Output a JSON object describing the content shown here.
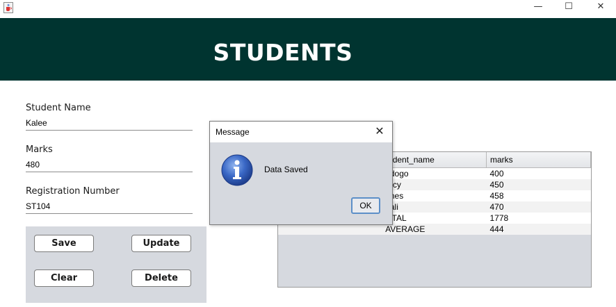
{
  "window": {
    "minimize_glyph": "—",
    "maximize_glyph": "☐",
    "close_glyph": "✕",
    "icon": "java-cup-icon"
  },
  "header": {
    "title": "STUDENTS"
  },
  "form": {
    "student_name_label": "Student Name",
    "student_name_value": "Kalee",
    "marks_label": "Marks",
    "marks_value": "480",
    "reg_label": "Registration Number",
    "reg_value": "ST104"
  },
  "buttons": {
    "save": "Save",
    "update": "Update",
    "clear": "Clear",
    "delete": "Delete"
  },
  "table": {
    "columns": [
      "",
      "tudent_name",
      "marks"
    ],
    "rows": [
      [
        "",
        "adogo",
        "400"
      ],
      [
        "",
        "ercy",
        "450"
      ],
      [
        "",
        "ones",
        "458"
      ],
      [
        "",
        "hali",
        "470"
      ],
      [
        "",
        "OTAL",
        "1778"
      ],
      [
        "",
        "AVERAGE",
        "444"
      ]
    ]
  },
  "dialog": {
    "title": "Message",
    "close_glyph": "✕",
    "message": "Data Saved",
    "ok_label": "OK",
    "icon": "info-icon"
  },
  "colors": {
    "header_bg": "#003430",
    "panel_bg": "#d6d9df",
    "ok_border": "#5c8fc8",
    "info_icon_blue": "#2f5db8"
  }
}
